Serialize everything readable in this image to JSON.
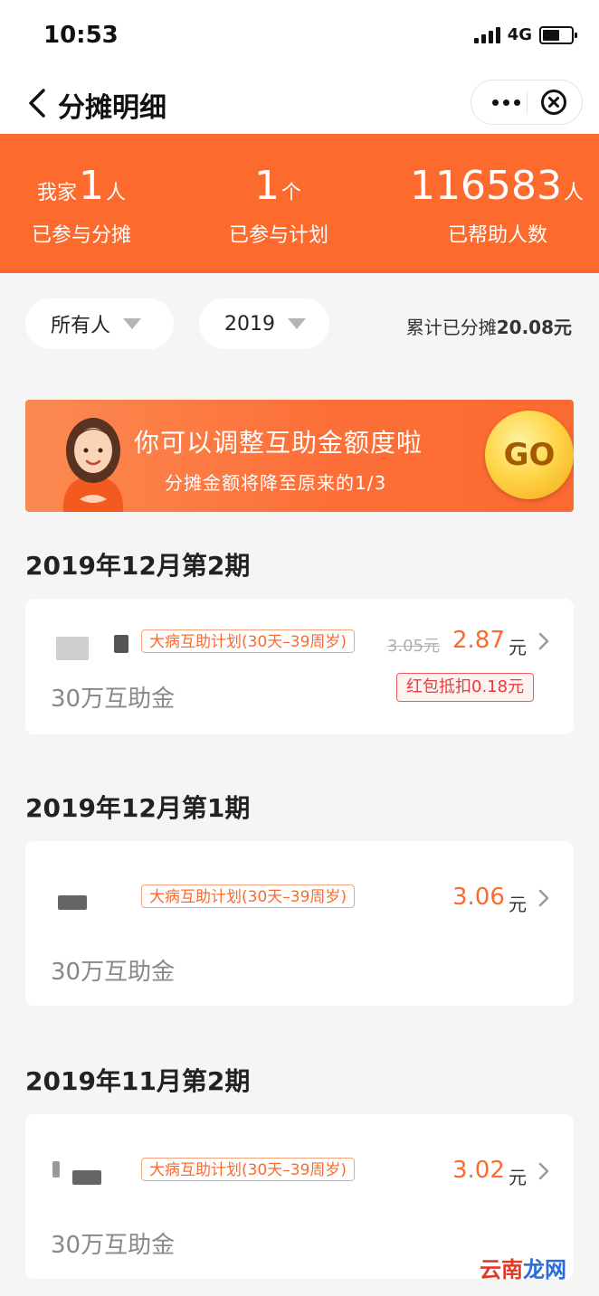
{
  "status_bar": {
    "time": "10:53",
    "network": "4G"
  },
  "nav": {
    "title": "分摊明细"
  },
  "summary": {
    "family": {
      "prefix": "我家",
      "value": "1",
      "unit": "人",
      "label": "已参与分摊"
    },
    "plans": {
      "value": "1",
      "unit": "个",
      "label": "已参与计划"
    },
    "helped": {
      "value": "116583",
      "unit": "人",
      "label": "已帮助人数"
    }
  },
  "filters": {
    "person": "所有人",
    "year": "2019",
    "total_prefix": "累计已分摊",
    "total_value": "20.08元"
  },
  "banner": {
    "title": "你可以调整互助金额度啦",
    "subtitle": "分摊金额将降至原来的1/3",
    "go_label": "GO"
  },
  "periods": [
    {
      "title": "2019年12月第2期",
      "plan_tag": "大病互助计划(30天–39周岁)",
      "original_price": "3.05元",
      "price": "2.87",
      "unit": "元",
      "subtitle": "30万互助金",
      "coupon": "红包抵扣0.18元"
    },
    {
      "title": "2019年12月第1期",
      "plan_tag": "大病互助计划(30天–39周岁)",
      "price": "3.06",
      "unit": "元",
      "subtitle": "30万互助金"
    },
    {
      "title": "2019年11月第2期",
      "plan_tag": "大病互助计划(30天–39周岁)",
      "price": "3.02",
      "unit": "元",
      "subtitle": "30万互助金"
    }
  ],
  "watermark": {
    "part1": "云南",
    "part2": "龙网"
  },
  "colors": {
    "accent": "#fc6a2e",
    "coupon": "#e83b3b"
  }
}
